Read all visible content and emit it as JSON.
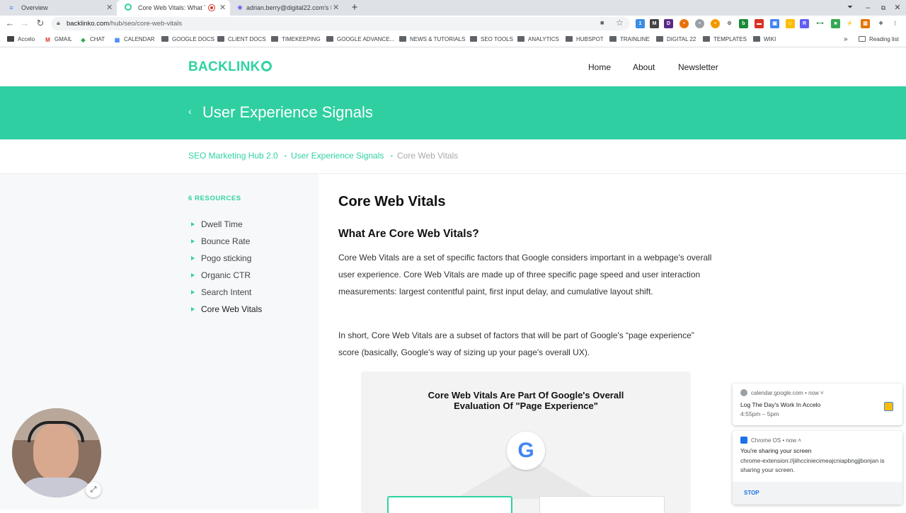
{
  "browser": {
    "tabs": [
      {
        "label": "Overview",
        "icon": "document-icon",
        "active": false
      },
      {
        "label": "Core Web Vitals: What They",
        "icon": "backlinko-icon",
        "active": true
      },
      {
        "label": "adrian.berry@digital22.com's Lo",
        "icon": "loom-icon",
        "active": false
      }
    ],
    "url_host": "backlinko.com",
    "url_path": "/hub/seo/core-web-vitals",
    "bookmarks": [
      "Accelo",
      "GMAIL",
      "CHAT",
      "CALENDAR",
      "GOOGLE DOCS",
      "CLIENT DOCS",
      "TIMEKEEPING",
      "GOOGLE ADVANCE...",
      "NEWS & TUTORIALS",
      "SEO TOOLS",
      "ANALYTICS",
      "HUBSPOT",
      "TRAINLINE",
      "DIGITAL 22",
      "TEMPLATES",
      "WIKI"
    ],
    "more_bookmarks": "»",
    "reading_list": "Reading list"
  },
  "site": {
    "logo": "BACKLINK",
    "nav": [
      "Home",
      "About",
      "Newsletter"
    ],
    "hero_title": "User Experience Signals",
    "back_glyph": "‹",
    "breadcrumb": [
      "SEO Marketing Hub 2.0",
      "User Experience Signals",
      "Core Web Vitals"
    ],
    "breadcrumb_sep": "•"
  },
  "sidebar": {
    "heading": "6 RESOURCES",
    "items": [
      "Dwell Time",
      "Bounce Rate",
      "Pogo sticking",
      "Organic CTR",
      "Search Intent",
      "Core Web Vitals"
    ]
  },
  "article": {
    "title": "Core Web Vitals",
    "subtitle": "What Are Core Web Vitals?",
    "p1": "Core Web Vitals are a set of specific factors that Google considers important in a webpage's overall user experience. Core Web Vitals are made up of three specific page speed and user interaction measurements: largest contentful paint, first input delay, and cumulative layout shift.",
    "p2": "In short, Core Web Vitals are a subset of factors that will be part of Google's “page experience” score (basically, Google's way of sizing up your page's overall UX).",
    "figure_title_1": "Core Web Vitals Are Part Of Google's Overall",
    "figure_title_2": "Evaluation Of \"Page Experience\"",
    "figure_logo": "G"
  },
  "notifications": [
    {
      "source": "calendar.google.com • now ˅",
      "title": "Log The Day's Work In Accelo",
      "detail": "4:55pm – 5pm"
    },
    {
      "source": "Chrome OS • now ˄",
      "title": "You're sharing your screen",
      "detail1": "chrome-extension://jiihcciniecimeajcniapbngjjbonjan is",
      "detail2": "sharing your screen.",
      "action": "STOP"
    }
  ],
  "colors": {
    "brand": "#2ed3a2",
    "hero": "#2fcfa1"
  }
}
